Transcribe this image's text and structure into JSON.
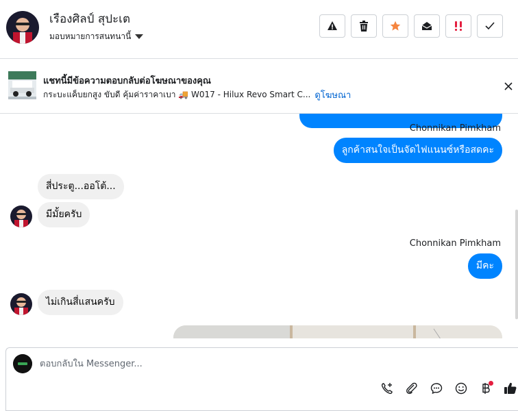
{
  "header": {
    "contact_name": "เรืองศิลป์ สุปะเต",
    "assign_label": "มอบหมายการสนทนานี้",
    "actions": [
      {
        "id": "spam",
        "icon": "warning-icon"
      },
      {
        "id": "delete",
        "icon": "trash-icon"
      },
      {
        "id": "star",
        "icon": "star-icon",
        "color": "#f5853f"
      },
      {
        "id": "unread",
        "icon": "envelope-open-icon"
      },
      {
        "id": "follow-up",
        "icon": "double-exclamation-icon",
        "color": "#e41e3f"
      },
      {
        "id": "done",
        "icon": "check-icon"
      }
    ]
  },
  "ad": {
    "title": "แชทนี้มีข้อความตอบกลับต่อโฆษณาของคุณ",
    "subtitle_text": "กระบะแค็บยกสูง ขับดี คุ้มค่าราคาเบา 🚚 W017 - Hilux Revo Smart C...",
    "link": "ดูโฆษณา"
  },
  "messages": {
    "sender_name_1": "Chonnikan Pimkham",
    "out_1": "ลูกค้าสนใจเป็นจัดไฟแนนซ์หรือสดคะ",
    "in_1": "สี่ประตู...ออโต้...",
    "in_2": "มีมั้ยครับ",
    "sender_name_2": "Chonnikan Pimkham",
    "out_2": "มีคะ",
    "in_3": "ไม่เกินสี่แสนครับ"
  },
  "composer": {
    "placeholder": "ตอบกลับใน Messenger...",
    "tools": [
      "add-contact-icon",
      "attachment-icon",
      "saved-reply-icon",
      "emoji-icon",
      "baht-icon",
      "thumbs-up-icon"
    ]
  },
  "colors": {
    "accent": "#0084ff",
    "incoming_bubble": "#f0f0f0",
    "link": "#0064d1"
  }
}
